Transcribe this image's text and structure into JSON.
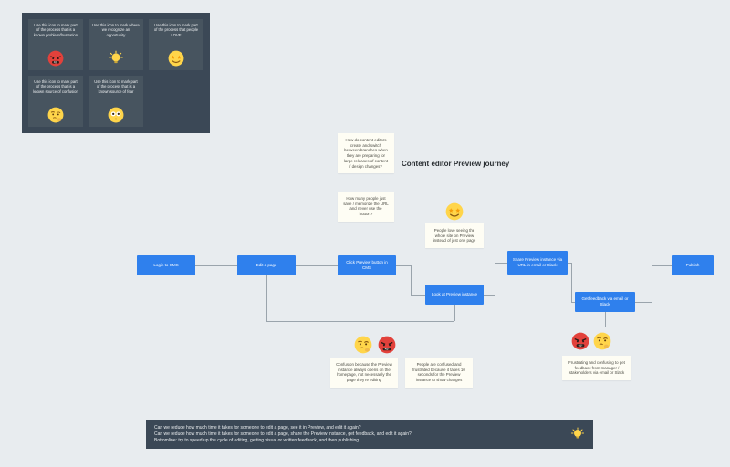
{
  "title": "Content editor Preview journey",
  "legend": {
    "problem": "Use this icon to mark part of the process that is a known problem/frustration",
    "opportunity": "Use this icon to mark where we recognize an opportunity",
    "love": "Use this icon to mark part of the process that people LOVE",
    "confusion": "Use this icon to mark part of the process that is a known source of confusion",
    "fear": "Use this icon to mark part of the process that is a known source of fear"
  },
  "flow": {
    "login": "Login to CMS",
    "edit": "Edit a page",
    "click_preview": "Click Preview button in CMS",
    "look_preview": "Look at Preview instance",
    "share": "Share Preview instance via URL in email or Slack",
    "feedback": "Get feedback via email or Slack",
    "publish": "Publish"
  },
  "notes": {
    "branches": "How do content editors create and switch between branches when they are preparing for large releases of content / design changes?",
    "memorize": "How many people just save / memorize the URL and never use the button?",
    "love_whole": "People love seeing the whole site on Preview instead of just one page",
    "confusion_home": "Confusion because the Preview instance always opens on the homepage, not necessarily the page they're editing",
    "frustrated_10s": "People are confused and frustrated because it takes 10 seconds for the Preview instance to show changes",
    "feedback_bad": "Frustrating and confusing to get feedback from manager / stakeholders via email or Slack"
  },
  "summary": {
    "line1": "Can we reduce how much time it takes for someone to edit a page, see it in Preview, and edit it again?",
    "line2": "Can we reduce how much time it takes for someone to edit a page, share the Preview instance, get feedback, and edit it again?",
    "line3": "Bottomline: try to speed up the cycle of editing, getting visual or written feedback, and then publishing"
  },
  "colors": {
    "accent": "#2f80ed",
    "panel": "#3b4856",
    "canvas": "#e8ecef"
  }
}
